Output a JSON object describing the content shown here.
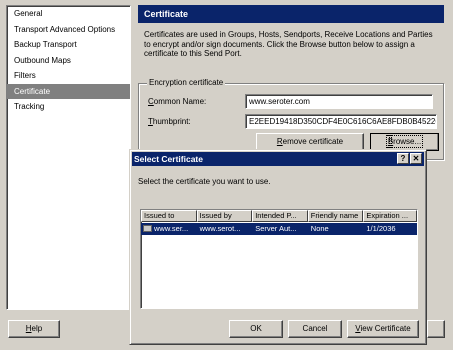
{
  "nav": {
    "items": [
      {
        "label": "General"
      },
      {
        "label": "Transport Advanced Options"
      },
      {
        "label": "Backup Transport"
      },
      {
        "label": "Outbound Maps"
      },
      {
        "label": "Filters"
      },
      {
        "label": "Certificate",
        "selected": true
      },
      {
        "label": "Tracking"
      }
    ]
  },
  "help_button": {
    "pre": "",
    "underlined": "H",
    "post": "elp"
  },
  "pane": {
    "title": "Certificate",
    "description": "Certificates are used in Groups, Hosts, Sendports, Receive Locations and Parties to encrypt and/or sign documents. Click the Browse button below to assign a certificate to this Send Port.",
    "group_title": "Encryption certificate",
    "common_name": {
      "pre": "",
      "underlined": "C",
      "post": "ommon Name:",
      "value": "www.seroter.com"
    },
    "thumbprint": {
      "pre": "",
      "underlined": "T",
      "post": "humbprint:",
      "value": "E2EED19418D350CDF4E0C616C6AE8FDB0B452267"
    },
    "remove_button": {
      "pre": "",
      "underlined": "R",
      "post": "emove certificate"
    },
    "browse_button": {
      "pre": "",
      "underlined": "B",
      "post": "rowse..."
    }
  },
  "dialog": {
    "title": "Select Certificate",
    "help_glyph": "?",
    "close_glyph": "✕",
    "prompt": "Select the certificate you want to use.",
    "columns": [
      "Issued to",
      "Issued by",
      "Intended P...",
      "Friendly name",
      "Expiration ..."
    ],
    "rows": [
      {
        "issued_to": "www.ser...",
        "issued_by": "www.serot...",
        "intended": "Server Aut...",
        "friendly": "None",
        "expiration": "1/1/2036"
      }
    ],
    "ok_label": "OK",
    "cancel_label": "Cancel",
    "view_button": {
      "pre": "",
      "underlined": "V",
      "post": "iew Certificate"
    }
  },
  "colors": {
    "titlebar": "#0a246a",
    "face": "#d4d0c8",
    "nav_selected": "#808080"
  }
}
